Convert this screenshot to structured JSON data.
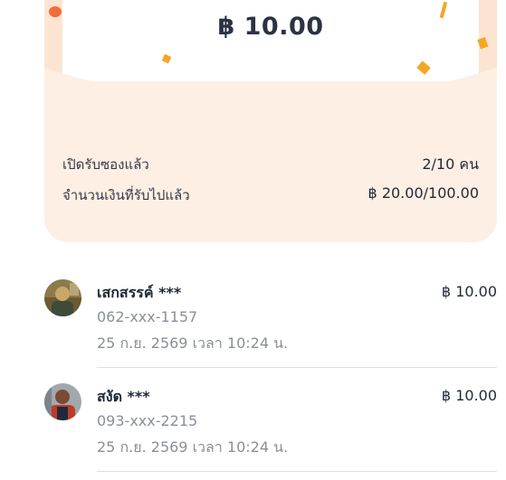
{
  "envelope": {
    "amount": "฿ 10.00",
    "opened_label": "เปิดรับซองแล้ว",
    "opened_value": "2/10 คน",
    "received_label": "จำนวนเงินที่รับไปแล้ว",
    "received_value": "฿ 20.00/100.00",
    "colors": {
      "card_bg": "#fdefe4",
      "confetti_orange": "#f5a623",
      "confetti_red": "#f26b3a"
    }
  },
  "recipients": [
    {
      "name": "เสกสรรค์ ***",
      "amount": "฿ 10.00",
      "phone": "062-xxx-1157",
      "time": "25 ก.ย. 2569 เวลา 10:24 น."
    },
    {
      "name": "สงัด ***",
      "amount": "฿ 10.00",
      "phone": "093-xxx-2215",
      "time": "25 ก.ย. 2569 เวลา 10:24 น."
    }
  ]
}
